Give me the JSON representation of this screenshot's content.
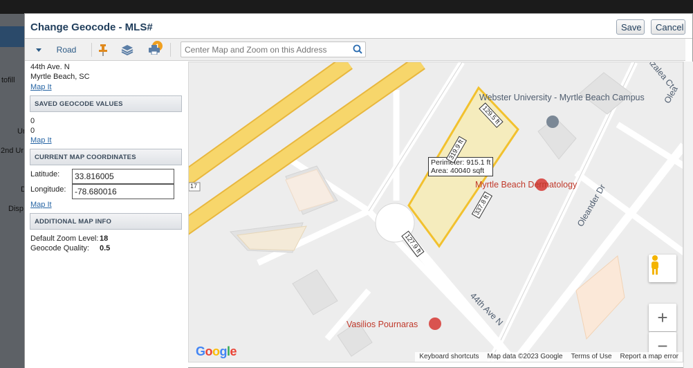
{
  "background": {
    "labels": [
      "tofill",
      "Ur",
      "2nd Ur",
      "D",
      "Disp"
    ]
  },
  "modal": {
    "title": "Change Geocode - MLS#",
    "save_label": "Save",
    "cancel_label": "Cancel"
  },
  "toolbar": {
    "view_mode": "Road",
    "layers_badge": "1",
    "search_placeholder": "Center Map and Zoom on this Address"
  },
  "address": {
    "line1": "44th Ave. N",
    "line2": "Myrtle Beach, SC",
    "map_it": "Map It"
  },
  "saved": {
    "header": "SAVED GEOCODE VALUES",
    "value1": "0",
    "value2": "0",
    "map_it": "Map It"
  },
  "current": {
    "header": "CURRENT MAP COORDINATES",
    "latitude_label": "Latitude:",
    "latitude": "33.816005",
    "longitude_label": "Longitude:",
    "longitude": "-78.680016",
    "map_it": "Map It"
  },
  "additional": {
    "header": "ADDITIONAL MAP INFO",
    "zoom_label": "Default Zoom Level:",
    "zoom_value": "18",
    "quality_label": "Geocode Quality:",
    "quality_value": "0.5"
  },
  "map": {
    "poi_webster": "Webster University - Myrtle Beach Campus",
    "poi_derm": "Myrtle Beach Dermatology",
    "poi_vasilios": "Vasilios Pournaras",
    "road_oleander": "Oleander Dr",
    "road_44th": "44th Ave N",
    "road_azalea": "Azalea Ct",
    "road_oleander_top": "Olea",
    "route_shield": "17",
    "perimeter": "Perimeter: 915.1 ft",
    "area": "Area: 40040 sqft",
    "edge_top": "129.5 ft",
    "edge_left": "319.9 ft",
    "edge_right": "337.8 ft",
    "edge_bottom": "127.9 ft",
    "attribution": [
      "Keyboard shortcuts",
      "Map data ©2023 Google",
      "Terms of Use",
      "Report a map error"
    ],
    "google": "Google",
    "polygon_color": "#f2c12e",
    "road_color": "#f7d66b"
  }
}
